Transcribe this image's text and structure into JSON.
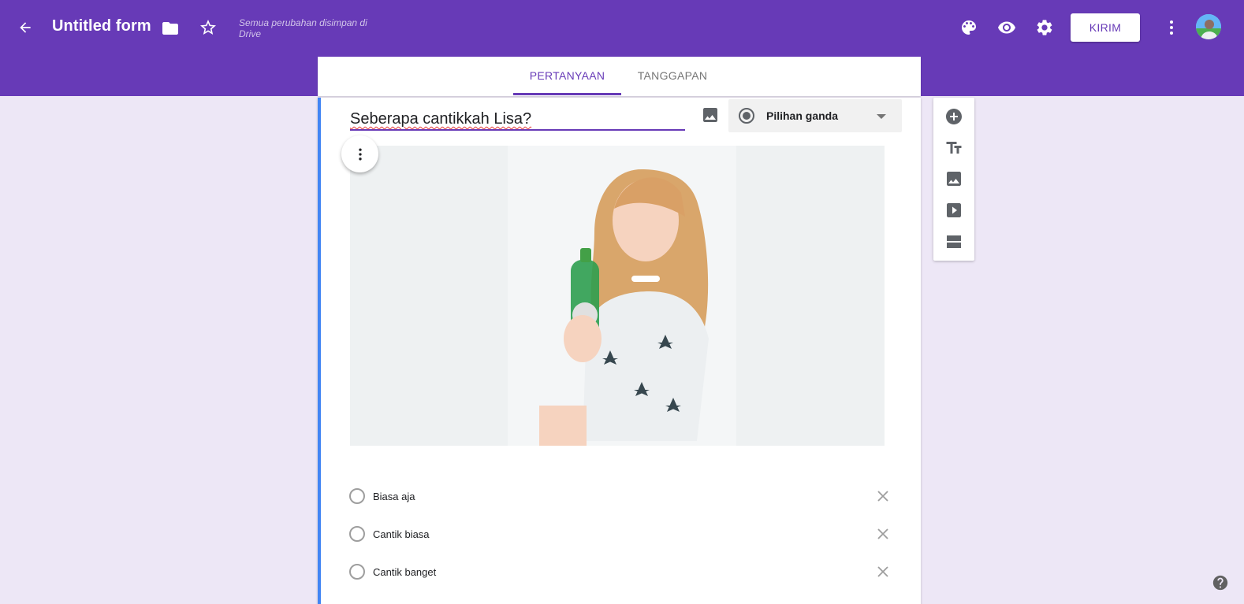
{
  "header": {
    "back_icon": "arrow-left-icon",
    "title": "Untitled form",
    "folder_icon": "folder-icon",
    "star_icon": "star-outline-icon",
    "save_status": "Semua perubahan disimpan di Drive",
    "palette_icon": "palette-icon",
    "preview_icon": "eye-icon",
    "settings_icon": "gear-icon",
    "send_label": "KIRIM",
    "more_icon": "vertical-dots-icon",
    "brand_color": "#673ab7"
  },
  "tabs": [
    {
      "label": "PERTANYAAN",
      "active": true
    },
    {
      "label": "TANGGAPAN",
      "active": false
    }
  ],
  "question": {
    "title": "Seberapa cantikkah Lisa?",
    "add_image_icon": "image-icon",
    "type_icon": "radio-checked-icon",
    "type_label": "Pilihan ganda",
    "type_dropdown_icon": "caret-down-icon",
    "options": [
      {
        "label": "Biasa aja"
      },
      {
        "label": "Cantik biasa"
      },
      {
        "label": "Cantik banget"
      }
    ]
  },
  "side_toolbar": [
    {
      "icon": "add-circle-icon"
    },
    {
      "icon": "title-text-icon"
    },
    {
      "icon": "image-icon"
    },
    {
      "icon": "video-icon"
    },
    {
      "icon": "section-icon"
    }
  ],
  "help_icon": "help-circle-icon"
}
